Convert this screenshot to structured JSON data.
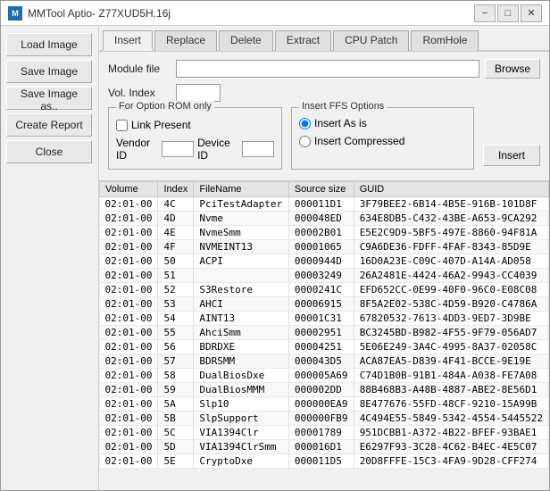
{
  "window": {
    "title": "MMTool Aptio- Z77XUD5H.16j",
    "icon": "M"
  },
  "title_buttons": {
    "minimize": "−",
    "maximize": "□",
    "close": "✕"
  },
  "sidebar": {
    "buttons": [
      "Load Image",
      "Save Image",
      "Save Image as..",
      "Create Report",
      "Close"
    ]
  },
  "tabs": [
    {
      "label": "Insert",
      "active": true
    },
    {
      "label": "Replace"
    },
    {
      "label": "Delete"
    },
    {
      "label": "Extract"
    },
    {
      "label": "CPU Patch"
    },
    {
      "label": "RomHole"
    }
  ],
  "form": {
    "module_file_label": "Module file",
    "vol_index_label": "Vol. Index",
    "browse_label": "Browse",
    "for_option_rom_label": "For Option ROM only",
    "link_present_label": "Link Present",
    "vendor_id_label": "Vendor ID",
    "device_id_label": "Device ID",
    "insert_ffs_label": "Insert FFS Options",
    "insert_as_is_label": "Insert As is",
    "insert_compressed_label": "Insert Compressed",
    "insert_label": "Insert"
  },
  "table": {
    "columns": [
      "Volume",
      "Index",
      "FileName",
      "Source size",
      "GUID"
    ],
    "rows": [
      [
        "02:01-00",
        "4C",
        "PciTestAdapter",
        "000011D1",
        "3F79BEE2-6B14-4B5E-916B-101D8F"
      ],
      [
        "02:01-00",
        "4D",
        "Nvme",
        "000048ED",
        "634E8DB5-C432-43BE-A653-9CA292"
      ],
      [
        "02:01-00",
        "4E",
        "NvmeSmm",
        "00002B01",
        "E5E2C9D9-5BF5-497E-8860-94F81A"
      ],
      [
        "02:01-00",
        "4F",
        "NVMEINT13",
        "00001065",
        "C9A6DE36-FDFF-4FAF-8343-85D9E"
      ],
      [
        "02:01-00",
        "50",
        "ACPI",
        "0000944D",
        "16D0A23E-C09C-407D-A14A-AD058"
      ],
      [
        "02:01-00",
        "51",
        "",
        "00003249",
        "26A2481E-4424-46A2-9943-CC4039"
      ],
      [
        "02:01-00",
        "52",
        "S3Restore",
        "0000241C",
        "EFD652CC-0E99-40F0-96C0-E08C08"
      ],
      [
        "02:01-00",
        "53",
        "AHCI",
        "00006915",
        "8F5A2E02-538C-4D59-B920-C4786A"
      ],
      [
        "02:01-00",
        "54",
        "AINT13",
        "00001C31",
        "67820532-7613-4DD3-9ED7-3D9BE"
      ],
      [
        "02:01-00",
        "55",
        "AhciSmm",
        "00002951",
        "BC3245BD-B982-4F55-9F79-056AD7"
      ],
      [
        "02:01-00",
        "56",
        "BDRDXE",
        "00004251",
        "5E06E249-3A4C-4995-8A37-02058C"
      ],
      [
        "02:01-00",
        "57",
        "BDRSMM",
        "000043D5",
        "ACA87EA5-D839-4F41-BCCE-9E19E"
      ],
      [
        "02:01-00",
        "58",
        "DualBiosDxe",
        "000005A69",
        "C74D1B0B-91B1-484A-A038-FE7A08"
      ],
      [
        "02:01-00",
        "59",
        "DualBiosMMM",
        "000002DD",
        "88B468B3-A48B-4887-ABE2-8E56D1"
      ],
      [
        "02:01-00",
        "5A",
        "Slp10",
        "000000EA9",
        "8E477676-55FD-48CF-9210-15A99B"
      ],
      [
        "02:01-00",
        "5B",
        "SlpSupport",
        "000000FB9",
        "4C494E55-5849-5342-4554-5445522"
      ],
      [
        "02:01-00",
        "5C",
        "VIA1394Clr",
        "00001789",
        "951DCBB1-A372-4B22-BFEF-93BAE1"
      ],
      [
        "02:01-00",
        "5D",
        "VIA1394ClrSmm",
        "000016D1",
        "E6297F93-3C28-4C62-B4EC-4E5C07"
      ],
      [
        "02:01-00",
        "5E",
        "CryptoDxe",
        "000011D5",
        "20D8FFFE-15C3-4FA9-9D28-CFF274"
      ]
    ]
  }
}
